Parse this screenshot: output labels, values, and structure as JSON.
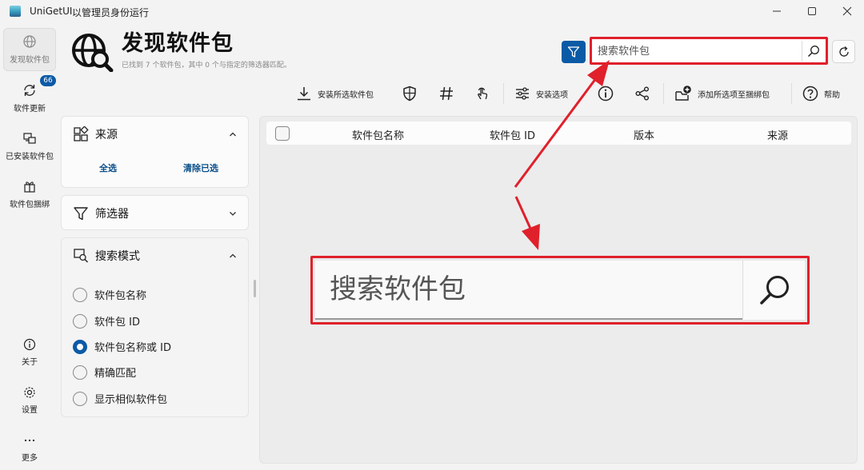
{
  "titlebar": {
    "app_name": "UniGetUI",
    "admin_note": "以管理员身份运行"
  },
  "nav": {
    "discover": "发现软件包",
    "updates": "软件更新",
    "updates_badge": "66",
    "installed": "已安装软件包",
    "bundles": "软件包捆绑",
    "about": "关于",
    "settings": "设置",
    "more": "更多"
  },
  "header": {
    "title": "发现软件包",
    "subtitle": "已找到 7 个软件包，其中 0 个与指定的筛选器匹配。"
  },
  "search": {
    "placeholder": "搜索软件包"
  },
  "toolbar": {
    "install_selected": "安装所选软件包",
    "install_options": "安装选项",
    "add_to_bundle": "添加所选项至捆绑包",
    "help": "帮助"
  },
  "sources_panel": {
    "title": "来源",
    "select_all": "全选",
    "clear_selection": "清除已选"
  },
  "filters_panel": {
    "title": "筛选器"
  },
  "search_mode_panel": {
    "title": "搜索模式",
    "options": [
      "软件包名称",
      "软件包 ID",
      "软件包名称或 ID",
      "精确匹配",
      "显示相似软件包"
    ],
    "selected_index": 2
  },
  "table": {
    "columns": [
      "软件包名称",
      "软件包 ID",
      "版本",
      "来源"
    ]
  },
  "callout": {
    "text": "搜索软件包"
  },
  "colors": {
    "accent": "#0b5aa6",
    "highlight": "#e0202a"
  }
}
